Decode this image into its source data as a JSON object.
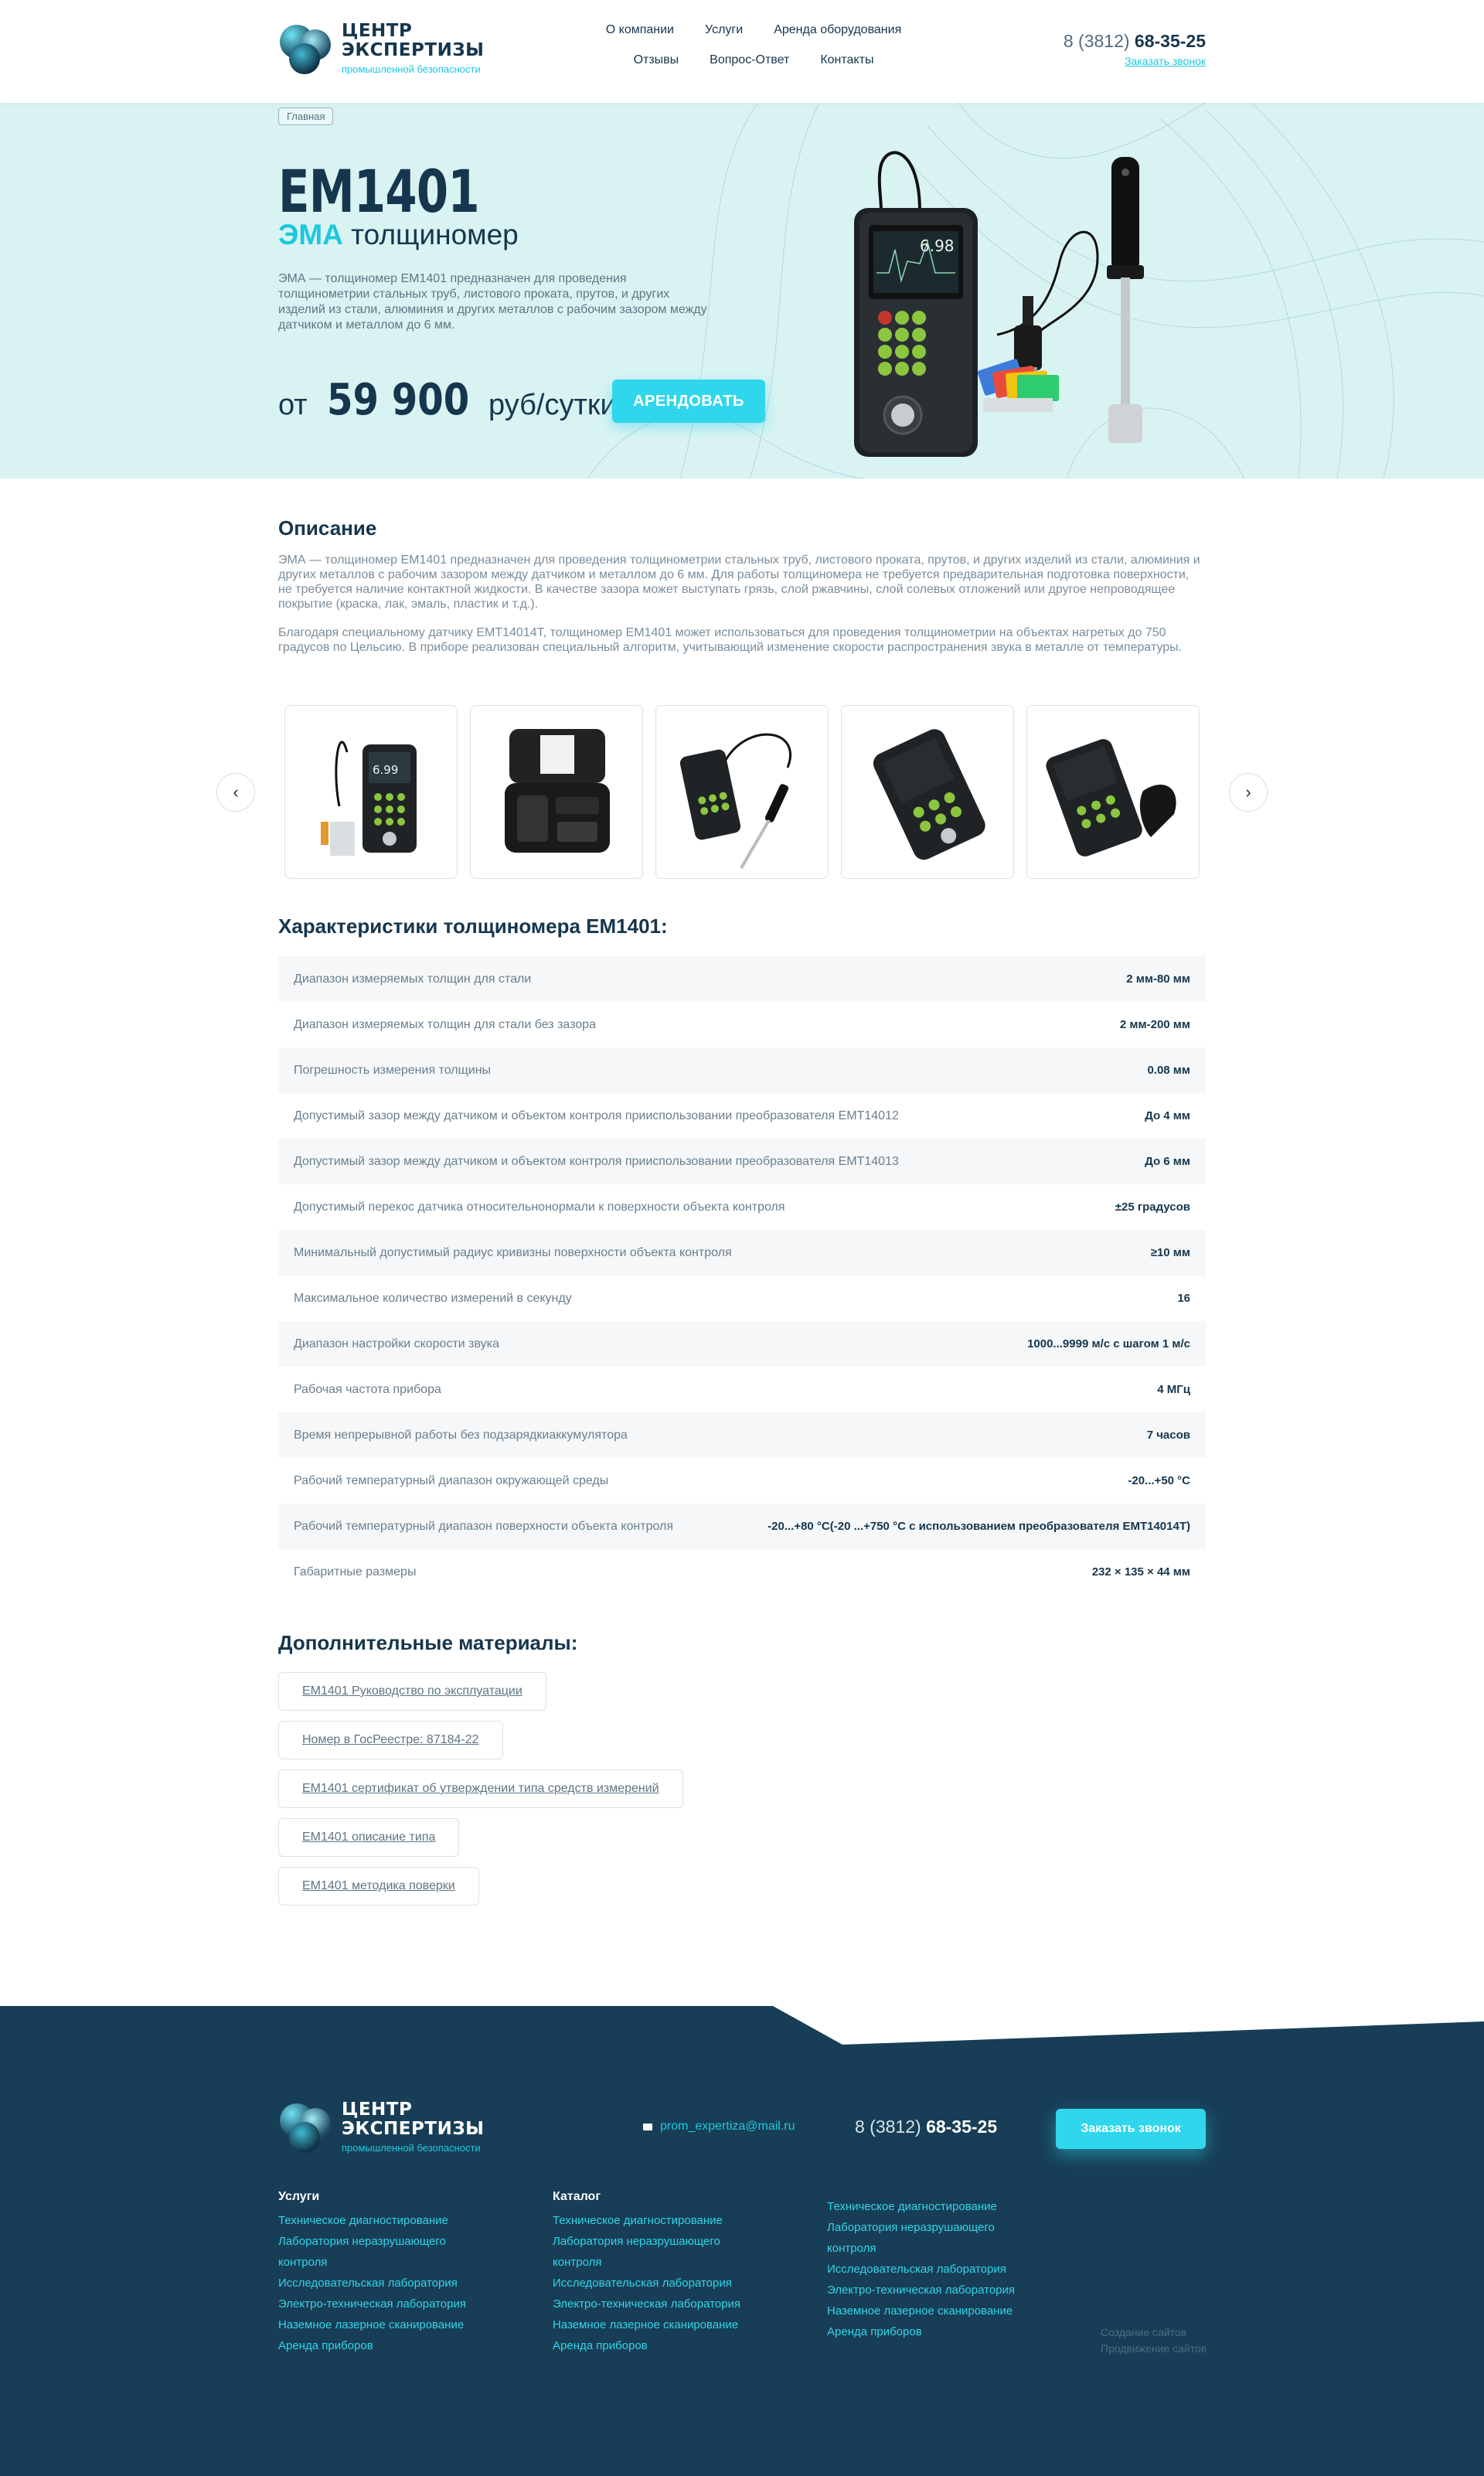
{
  "header": {
    "logo": {
      "line1": "ЦЕНТР",
      "line2": "ЭКСПЕРТИЗЫ",
      "line3": "промышленной безопасности"
    },
    "nav_row1": [
      "О компании",
      "Услуги",
      "Аренда оборудования"
    ],
    "nav_row2": [
      "Отзывы",
      "Вопрос-Ответ",
      "Контакты"
    ],
    "phone_prefix": "8 (3812)",
    "phone_main": "68-35-25",
    "call_link": "Заказать звонок"
  },
  "hero": {
    "breadcrumb": "Главная",
    "title": "EM1401",
    "subtitle_accent": "ЭМА",
    "subtitle_rest": "толщиномер",
    "description": "ЭМА — толщиномер ЕМ1401 предназначен для проведения толщинометрии стальных труб, листового проката, прутов, и других изделий из стали, алюминия и других металлов с рабочим зазором между датчиком и металлом до 6 мм.",
    "price_from": "от",
    "price_value": "59 900",
    "price_unit": "руб/сутки",
    "rent_button": "АРЕНДОВАТЬ",
    "device_screen_value": "6.98"
  },
  "description": {
    "title": "Описание",
    "paragraphs": [
      "ЭМА — толщиномер ЕМ1401 предназначен для проведения толщинометрии стальных труб, листового проката, прутов, и других изделий из стали, алюминия и других металлов с рабочим зазором между датчиком и металлом до 6 мм. Для работы толщиномера не требуется предварительная подготовка поверхности, не требуется наличие контактной жидкости. В качестве зазора может выступать грязь, слой ржавчины, слой солевых отложений или другое непроводящее покрытие (краска, лак, эмаль, пластик и т.д.).",
      "Благодаря специальному датчику ЕМТ14014Т, толщиномер ЕМ1401 может использоваться для проведения толщинометрии на объектах нагретых до 750 градусов по Цельсию. В приборе реализован специальный алгоритм, учитывающий изменение скорости распространения звука в металле от температуры."
    ]
  },
  "gallery": {
    "prev_icon": "chevron-left-icon",
    "next_icon": "chevron-right-icon",
    "first_screen_value": "6.99",
    "items": [
      "device-with-probe",
      "device-case",
      "device-with-pen-probe",
      "device-front",
      "device-angled"
    ]
  },
  "specs": {
    "title": "Характеристики толщиномера ЕМ1401:",
    "rows": [
      {
        "k": "Диапазон измеряемых толщин для стали",
        "v": "2 мм-80 мм"
      },
      {
        "k": "Диапазон измеряемых толщин для стали без зазора",
        "v": "2 мм-200 мм"
      },
      {
        "k": "Погрешность измерения толщины",
        "v": "0.08 мм"
      },
      {
        "k": "Допустимый зазор между датчиком и объектом контроля прииспользовании преобразователя ЕМТ14012",
        "v": "До 4 мм"
      },
      {
        "k": "Допустимый зазор между датчиком и объектом контроля прииспользовании преобразователя ЕМТ14013",
        "v": "До 6 мм"
      },
      {
        "k": "Допустимый перекос датчика относительнонормали к поверхности объекта контроля",
        "v": "±25 градусов"
      },
      {
        "k": "Минимальный допустимый радиус кривизны поверхности объекта контроля",
        "v": "≥10 мм"
      },
      {
        "k": "Максимальное количество измерений в секунду",
        "v": "16"
      },
      {
        "k": "Диапазон настройки скорости звука",
        "v": "1000...9999 м/с с шагом 1 м/с"
      },
      {
        "k": "Рабочая частота прибора",
        "v": "4 МГц"
      },
      {
        "k": "Время непрерывной работы без подзарядкиаккумулятора",
        "v": "7 часов"
      },
      {
        "k": "Рабочий температурный диапазон окружающей среды",
        "v": "-20...+50 °С"
      },
      {
        "k": "Рабочий температурный диапазон поверхности объекта контроля",
        "v": "-20...+80 °С(-20 ...+750 °С с использованием преобразователя ЕМТ14014Т)"
      },
      {
        "k": "Габаритные размеры",
        "v": "232 × 135 × 44 мм"
      }
    ]
  },
  "materials": {
    "title": "Дополнительные материалы:",
    "items": [
      "ЕМ1401 Руководство по эксплуатации",
      "Номер в ГосРеестре: 87184-22",
      "ЕМ1401 сертификат об утверждении типа средств измерений",
      "ЕМ1401 описание типа",
      "ЕМ1401 методика поверки"
    ]
  },
  "footer": {
    "logo": {
      "line1": "ЦЕНТР",
      "line2": "ЭКСПЕРТИЗЫ",
      "line3": "промышленной безопасности"
    },
    "email": "prom_expertiza@mail.ru",
    "phone_prefix": "8 (3812)",
    "phone_main": "68-35-25",
    "call_button": "Заказать звонок",
    "columns": [
      {
        "heading": "Услуги",
        "links": [
          "Техническое диагностирование",
          "Лаборатория неразрушающего контроля",
          "Исследовательская лаборатория",
          "Электро-техническая лаборатория",
          "Наземное лазерное сканирование",
          "Арендa приборов"
        ]
      },
      {
        "heading": "Каталог",
        "links": [
          "Техническое диагностирование",
          "Лаборатория неразрушающего контроля",
          "Исследовательская лаборатория",
          "Электро-техническая лаборатория",
          "Наземное лазерное сканирование",
          "Арендa приборов"
        ]
      },
      {
        "heading": "",
        "links": [
          "Техническое диагностирование",
          "Лаборатория неразрушающего контроля",
          "Исследовательская лаборатория",
          "Электро-техническая лаборатория",
          "Наземное лазерное сканирование",
          "Арендa приборов"
        ]
      }
    ],
    "credits": [
      "Создание сайтов",
      "Продвижение сайтов"
    ]
  },
  "colors": {
    "accent": "#1dc8de",
    "dark": "#16364d",
    "hero_bg": "#d9f3f3",
    "footer_bg": "#173e56"
  }
}
